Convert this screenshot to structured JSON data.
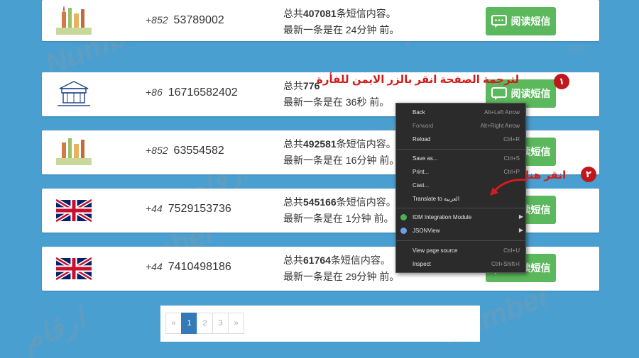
{
  "rows": [
    {
      "flag": "hk-icon",
      "cc": "+852",
      "number": "53789002",
      "sms_prefix": "总共",
      "sms_count": "407081",
      "sms_suffix": "条短信内容。",
      "latest": "最新一条是在 24分钟 前。",
      "button": "阅读短信"
    },
    {
      "flag": "china-icon",
      "cc": "+86",
      "number": "16716582402",
      "sms_prefix": "总共",
      "sms_count": "776",
      "sms_suffix": "",
      "latest": "最新一条是在 36秒 前。",
      "button": "阅读短信"
    },
    {
      "flag": "hk-icon",
      "cc": "+852",
      "number": "63554582",
      "sms_prefix": "总共",
      "sms_count": "492581",
      "sms_suffix": "条短信内容。",
      "latest": "最新一条是在 16分钟 前。",
      "button": "阅读短信"
    },
    {
      "flag": "uk-flag-icon",
      "cc": "+44",
      "number": "7529153736",
      "sms_prefix": "总共",
      "sms_count": "545166",
      "sms_suffix": "条短信内容。",
      "latest": "最新一条是在 1分钟 前。",
      "button": "阅读短信"
    },
    {
      "flag": "uk-flag-icon",
      "cc": "+44",
      "number": "7410498186",
      "sms_prefix": "总共",
      "sms_count": "61764",
      "sms_suffix": "条短信内容。",
      "latest": "最新一条是在 29分钟 前。",
      "button": "阅读短信"
    }
  ],
  "pagination": {
    "prev": "«",
    "pages": [
      "1",
      "2",
      "3"
    ],
    "next": "»",
    "active": "1"
  },
  "context_menu": {
    "back": {
      "label": "Back",
      "shortcut": "Alt+Left Arrow"
    },
    "forward": {
      "label": "Forward",
      "shortcut": "Alt+Right Arrow"
    },
    "reload": {
      "label": "Reload",
      "shortcut": "Ctrl+R"
    },
    "save_as": {
      "label": "Save as...",
      "shortcut": "Ctrl+S"
    },
    "print": {
      "label": "Print...",
      "shortcut": "Ctrl+P"
    },
    "cast": {
      "label": "Cast..."
    },
    "translate": {
      "label": "Translate to العربية"
    },
    "idm": {
      "label": "IDM Integration Module"
    },
    "jsonview": {
      "label": "JSONView"
    },
    "view_source": {
      "label": "View page source",
      "shortcut": "Ctrl+U"
    },
    "inspect": {
      "label": "Inspect",
      "shortcut": "Ctrl+Shift+I"
    }
  },
  "annotations": {
    "step1_number": "١",
    "step1_text": "لترجمة الصفحة انقر بالزر الايمن للفأرة",
    "step2_number": "٢",
    "step2_text": "انقر هنا"
  },
  "watermark": {
    "latin": "Number",
    "arabic": "ارقام",
    "tag": "MIX"
  },
  "colors": {
    "background": "#4a9fd1",
    "button": "#5cb85c",
    "annotation": "#d41c1c",
    "menu_bg": "#2b2b2b",
    "page_active": "#337ab7"
  }
}
